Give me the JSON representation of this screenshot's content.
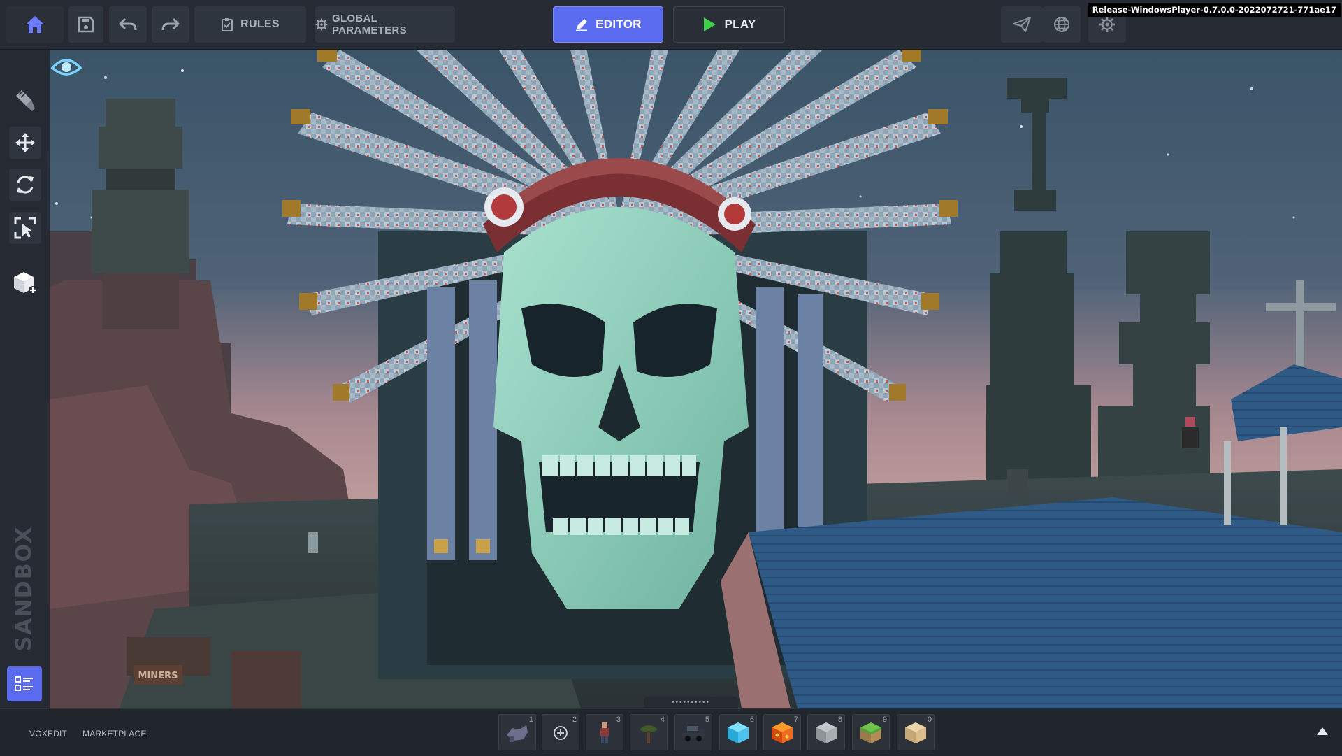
{
  "toolbar": {
    "rules_label": "RULES",
    "global_params_label": "GLOBAL PARAMETERS",
    "editor_label": "EDITOR",
    "play_label": "PLAY",
    "build_label": "Release-WindowsPlayer-0.7.0.0-2022072721-771ae17"
  },
  "colors": {
    "accent": "#5b6bf0",
    "play_green": "#3fcf4a",
    "bar_bg": "#262b33"
  },
  "left_tools": {
    "logo_text": "SANDBOX",
    "icons": [
      "paint-brush-icon",
      "move-icon",
      "rotate-icon",
      "select-icon",
      "add-cube-icon",
      "list-icon"
    ]
  },
  "bottom": {
    "voxedit_label": "VOXEDIT",
    "marketplace_label": "MARKETPLACE",
    "slots": [
      {
        "num": "1",
        "icon": "creature-asset"
      },
      {
        "num": "2",
        "icon": "add-circle-icon"
      },
      {
        "num": "3",
        "icon": "character-asset"
      },
      {
        "num": "4",
        "icon": "tree-asset"
      },
      {
        "num": "5",
        "icon": "vehicle-asset"
      },
      {
        "num": "6",
        "icon": "ice-block"
      },
      {
        "num": "7",
        "icon": "lava-block"
      },
      {
        "num": "8",
        "icon": "stone-block"
      },
      {
        "num": "9",
        "icon": "grass-block"
      },
      {
        "num": "0",
        "icon": "sand-block"
      }
    ]
  },
  "viewport": {
    "sign_text": "MINERS"
  }
}
